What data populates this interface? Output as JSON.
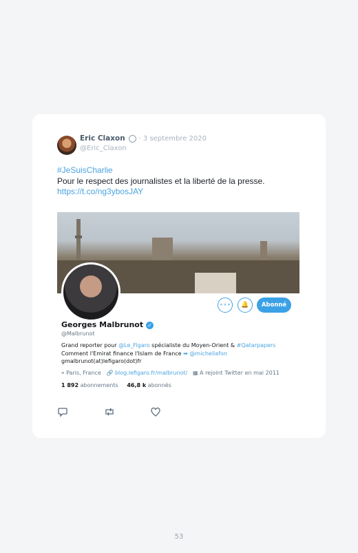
{
  "tweet": {
    "author_name": "Eric Claxon",
    "separator": "·",
    "date": "3 septembre 2020",
    "handle": "@Eric_Claxon",
    "hashtag": "#JeSuisCharlie",
    "text": "Pour le respect des journalistes et la liberté de la presse.",
    "link": "https://t.co/ng3ybosJAY"
  },
  "embed": {
    "buttons": {
      "more": "∘∘∘",
      "bell": "🔔",
      "follow": "Abonné"
    },
    "profile_name": "Georges Malbrunot",
    "profile_handle": "@Malbrunot",
    "bio_line1_prefix": "Grand reporter pour ",
    "bio_line1_link": "@Le_Figaro",
    "bio_line1_middle": " spécialiste du Moyen-Orient & ",
    "bio_line1_hashtag": "#Qatarpapers",
    "bio_line2_prefix": "Comment l'Emirat finance l'Islam de France ",
    "bio_line2_link": "@michellafon",
    "bio_line3": "gmalbrunot(at)lefigaro(dot)fr",
    "location": "Paris, France",
    "website": "blog.lefigaro.fr/malbrunot/",
    "joined": "A rejoint Twitter en mai 2011",
    "following_count": "1 892",
    "following_label": "abonnements",
    "followers_count": "46,8 k",
    "followers_label": "abonnés"
  },
  "icons": [
    "reply-icon",
    "retweet-icon",
    "like-icon",
    "verified-icon",
    "location-icon",
    "link-icon",
    "calendar-icon"
  ],
  "page_number": "53"
}
